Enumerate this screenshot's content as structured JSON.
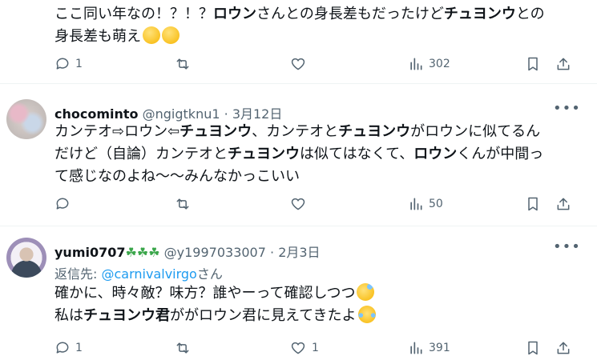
{
  "tweets": [
    {
      "body_lines": [
        [
          "ここ同い年なの！？！？",
          {
            "b": "ロウン"
          },
          "さんとの身長差もだったけど",
          {
            "b": "チュヨンウ"
          },
          "との"
        ],
        [
          "身長差も萌え"
        ]
      ],
      "emojis": [
        "hugging-face-emoji",
        "hugging-face-emoji"
      ],
      "actions": {
        "reply": "1",
        "retweet": "",
        "like": "",
        "views": "302"
      }
    },
    {
      "display_name": "chocominto",
      "handle": "@ngigtknu1",
      "date": "3月12日",
      "body_lines": [
        [
          "カンテオ⇨ロウン⇦",
          {
            "b": "チュヨンウ"
          },
          "、カンテオと",
          {
            "b": "チュヨンウ"
          },
          "がロウンに似てるん"
        ],
        [
          "だけど（自論）カンテオと",
          {
            "b": "チュヨンウ"
          },
          "は似てはなくて、",
          {
            "b": "ロウン"
          },
          "くんが中間っ"
        ],
        [
          "て感じなのよね〜〜みんなかっこいい"
        ]
      ],
      "actions": {
        "reply": "",
        "retweet": "",
        "like": "",
        "views": "50"
      }
    },
    {
      "display_name": "yumi0707",
      "name_emojis": [
        "shamrock-emoji",
        "shamrock-emoji",
        "shamrock-emoji"
      ],
      "handle": "@y1997033007",
      "date": "2月3日",
      "reply_prefix": "返信先: ",
      "reply_to": "@carnivalvirgo",
      "reply_suffix": "さん",
      "body_lines": [
        [
          "確かに、時々敵？味方？誰やーって確認しつつ"
        ],
        [
          "私は",
          {
            "b": "チュヨンウ君"
          },
          "ががロウン君に見えてきたよ"
        ]
      ],
      "line_emojis": [
        "sweat-smile-emoji",
        "laughing-tears-emoji"
      ],
      "actions": {
        "reply": "1",
        "retweet": "",
        "like": "1",
        "views": "391"
      }
    }
  ],
  "colors": {
    "text": "#0f1419",
    "secondary": "#536471",
    "link": "#1d9bf0",
    "divider": "#eff3f4"
  }
}
